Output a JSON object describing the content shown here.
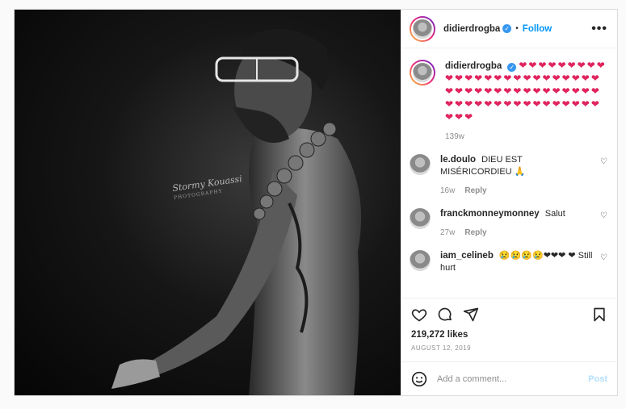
{
  "post": {
    "username": "didierdrogba",
    "follow_label": "Follow",
    "separator": "•",
    "more_label": "•••",
    "watermark": {
      "line1": "Stormy Kouassi",
      "line2": "PHOTOGRAPHY"
    }
  },
  "caption": {
    "username": "didierdrogba",
    "hearts": "❤❤❤❤❤❤❤❤❤❤❤❤❤❤❤❤❤❤❤❤❤❤❤❤❤❤❤❤❤❤❤❤❤❤❤❤❤❤❤❤❤❤❤❤❤❤❤❤❤❤❤❤❤❤❤❤❤❤❤❤",
    "time": "139w"
  },
  "comments": [
    {
      "username": "le.doulo",
      "text": "DIEU EST MISÉRICORDIEU 🙏",
      "time": "16w",
      "reply_label": "Reply"
    },
    {
      "username": "franckmonneymonney",
      "text": "Salut",
      "time": "27w",
      "reply_label": "Reply"
    },
    {
      "username": "iam_celineb",
      "text": "😢😢😢😢❤❤❤ ❤ Still hurt",
      "time": "",
      "reply_label": ""
    }
  ],
  "stats": {
    "likes": "219,272 likes",
    "date": "AUGUST 12, 2019"
  },
  "add_comment": {
    "placeholder": "Add a comment...",
    "post_label": "Post"
  },
  "colors": {
    "accent": "#0095f6",
    "verified": "#3897f0",
    "heart": "#e0245e",
    "post_disabled": "#b2dffc"
  },
  "icons": [
    "verified-badge-icon",
    "more-options-icon",
    "heart-icon",
    "comment-icon",
    "share-icon",
    "bookmark-icon",
    "emoji-icon"
  ]
}
